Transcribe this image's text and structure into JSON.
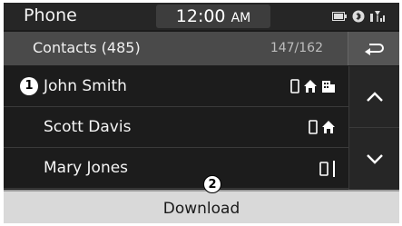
{
  "status": {
    "app_title": "Phone",
    "time": "12:00",
    "ampm": "AM",
    "icons": [
      "battery-icon",
      "bluetooth-icon",
      "signal-icon"
    ]
  },
  "header": {
    "title": "Contacts (485)",
    "count": "147/162",
    "back_icon": "back-arrow-icon"
  },
  "contacts": [
    {
      "name": "John Smith",
      "icons": [
        "mobile-icon",
        "home-icon",
        "office-icon"
      ]
    },
    {
      "name": "Scott Davis",
      "icons": [
        "mobile-icon",
        "home-icon"
      ]
    },
    {
      "name": "Mary Jones",
      "icons": [
        "mobile-icon"
      ]
    }
  ],
  "callouts": [
    "1",
    "2"
  ],
  "download": {
    "label": "Download"
  },
  "scroll": {
    "up_icon": "chevron-up-icon",
    "down_icon": "chevron-down-icon"
  }
}
